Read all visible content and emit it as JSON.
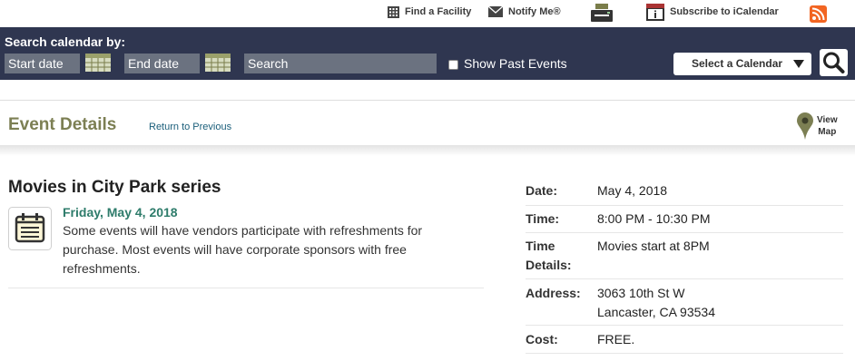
{
  "toolbar": {
    "find_facility": "Find a Facility",
    "notify_me": "Notify Me®",
    "subscribe": "Subscribe to iCalendar",
    "print_icon": "printer-icon",
    "rss_icon": "rss-icon"
  },
  "search": {
    "title": "Search calendar by:",
    "start_date": "Start date",
    "end_date": "End date",
    "search_text": "Search",
    "show_past": "Show Past Events",
    "select_calendar": "Select a Calendar"
  },
  "header": {
    "title": "Event Details",
    "return_link": "Return to Previous",
    "view_map": [
      "View",
      "Map"
    ]
  },
  "event": {
    "title": "Movies in City Park series",
    "date_heading": "Friday, May 4, 2018",
    "description": "Some events will have vendors participate with refreshments for purchase. Most events will have corporate sponsors with free refreshments."
  },
  "details": {
    "date_label": "Date:",
    "date_value": "May 4, 2018",
    "time_label": "Time:",
    "time_value": "8:00 PM - 10:30 PM",
    "time_details_label": [
      "Time",
      "Details:"
    ],
    "time_details_value": "Movies start at 8PM",
    "address_label": "Address:",
    "address_lines": [
      "3063 10th St W",
      "Lancaster, CA 93534"
    ],
    "cost_label": "Cost:",
    "cost_value": "FREE."
  },
  "colors": {
    "search_band": "#2f3650",
    "field_bg": "#6b7280",
    "header_title": "#7c7f53",
    "date_heading": "#2e7c6b",
    "link": "#1a5e7a",
    "rss": "#f26522"
  }
}
